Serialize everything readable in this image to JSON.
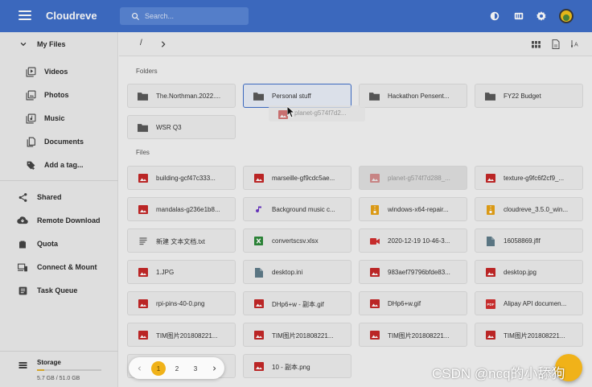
{
  "app": {
    "title": "Cloudreve"
  },
  "search": {
    "placeholder": "Search..."
  },
  "sidebar": {
    "my_files": "My Files",
    "items": [
      {
        "label": "Videos"
      },
      {
        "label": "Photos"
      },
      {
        "label": "Music"
      },
      {
        "label": "Documents"
      },
      {
        "label": "Add a tag..."
      }
    ],
    "menu": [
      {
        "label": "Shared"
      },
      {
        "label": "Remote Download"
      },
      {
        "label": "Quota"
      },
      {
        "label": "Connect & Mount"
      },
      {
        "label": "Task Queue"
      }
    ],
    "storage": {
      "label": "Storage",
      "value": "5.7 GB / 51.0 GB",
      "used_fraction": 0.11
    }
  },
  "toolbar": {
    "breadcrumb_root": "/"
  },
  "sections": {
    "folders": "Folders",
    "files": "Files"
  },
  "folders": [
    {
      "name": "The.Northman.2022...."
    },
    {
      "name": "Personal stuff"
    },
    {
      "name": "Hackathon Pensent..."
    },
    {
      "name": "FY22 Budget"
    },
    {
      "name": "WSR Q3"
    }
  ],
  "drag": {
    "name": "planet-g574f7d2..."
  },
  "files": [
    {
      "name": "building-gcf47c333...",
      "icon": "image"
    },
    {
      "name": "marseille-gf9cdc5ae...",
      "icon": "image"
    },
    {
      "name": "planet-g574f7d288_...",
      "icon": "image"
    },
    {
      "name": "texture-g9fc6f2cf9_...",
      "icon": "image"
    },
    {
      "name": "mandalas-g236e1b8...",
      "icon": "image"
    },
    {
      "name": "Background music c...",
      "icon": "music"
    },
    {
      "name": "windows-x64-repair...",
      "icon": "archive"
    },
    {
      "name": "cloudreve_3.5.0_win...",
      "icon": "archive"
    },
    {
      "name": "新建 文本文档.txt",
      "icon": "text"
    },
    {
      "name": "convertscsv.xlsx",
      "icon": "excel"
    },
    {
      "name": "2020-12-19 10-46-3...",
      "icon": "video"
    },
    {
      "name": "16058869.jflf",
      "icon": "file"
    },
    {
      "name": "1.JPG",
      "icon": "image"
    },
    {
      "name": "desktop.ini",
      "icon": "file"
    },
    {
      "name": "983aef79796bfde83...",
      "icon": "image"
    },
    {
      "name": "desktop.jpg",
      "icon": "image"
    },
    {
      "name": "rpi-pins-40-0.png",
      "icon": "image"
    },
    {
      "name": "DHp6+w - 副本.gif",
      "icon": "image"
    },
    {
      "name": "DHp6+w.gif",
      "icon": "image"
    },
    {
      "name": "Alipay API documen...",
      "icon": "pdf"
    },
    {
      "name": "TIM图片201808221...",
      "icon": "image"
    },
    {
      "name": "TIM图片201808221...",
      "icon": "image"
    },
    {
      "name": "TIM图片201808221...",
      "icon": "image"
    },
    {
      "name": "TIM图片201808221...",
      "icon": "image"
    },
    {
      "name": "11.png",
      "icon": "image"
    },
    {
      "name": "10 - 副本.png",
      "icon": "image"
    }
  ],
  "pagination": {
    "pages": [
      "1",
      "2",
      "3"
    ],
    "current": "1"
  },
  "watermark": "CSDN @ncq的小舔狗"
}
